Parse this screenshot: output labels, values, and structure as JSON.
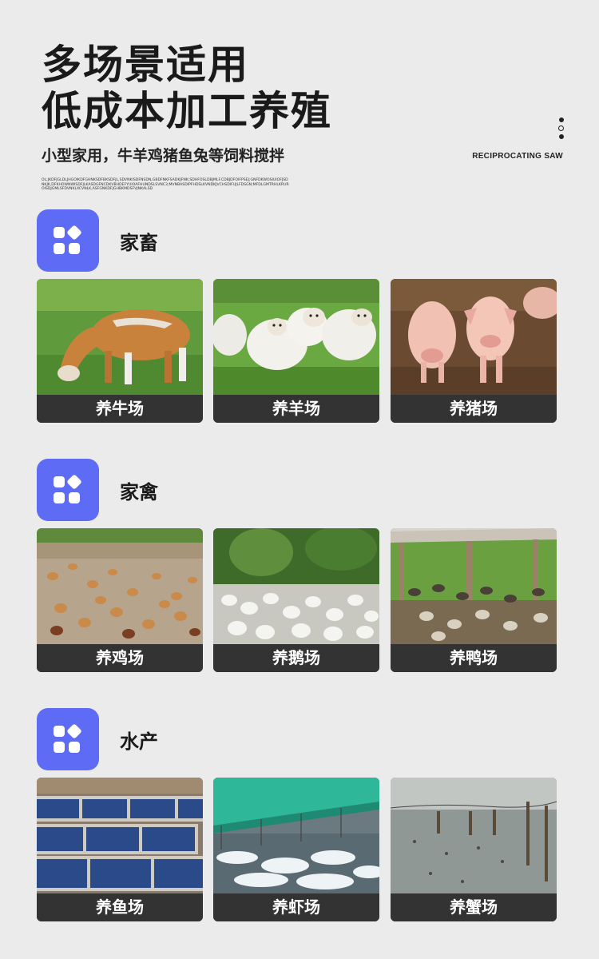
{
  "header": {
    "title_line1": "多场景适用",
    "title_line2": "低成本加工养殖",
    "subtitle": "小型家用，牛羊鸡猪鱼兔等饲料搅拌",
    "fineprint": "OL;JKDFJGLDLJHGOIKDFGHNKSDFBKSDFJL,SDVNKISDFNSDN,GBDFNKFSADKJFNK;SDHFOSLDBJMLF.CDBJDFOIFPSEJ;GNFDKWOSIUIOFJSDNKJK,DFKHOWNWISDFJLKASDGFNCDKVBHDEFYUIOAFHUNDSLSVNC3;MVNBASDIPFHDSLKVNDKJVCHSDIFUJLFDSGN;MFDLGMTRHLKRUROISDJGMLSFDVNKLXCVNLK,ASFGNKDFJGHBKMDSFVJNKALSD",
    "brand": "RECIPROCATING SAW"
  },
  "sections": [
    {
      "icon": "grid-apps-icon",
      "title": "家畜",
      "cards": [
        {
          "label": "养牛场",
          "image": "cow-photo"
        },
        {
          "label": "养羊场",
          "image": "sheep-photo"
        },
        {
          "label": "养猪场",
          "image": "pig-photo"
        }
      ]
    },
    {
      "icon": "grid-apps-icon",
      "title": "家禽",
      "cards": [
        {
          "label": "养鸡场",
          "image": "chicken-photo"
        },
        {
          "label": "养鹅场",
          "image": "goose-photo"
        },
        {
          "label": "养鸭场",
          "image": "duck-photo"
        }
      ]
    },
    {
      "icon": "grid-apps-icon",
      "title": "水产",
      "cards": [
        {
          "label": "养鱼场",
          "image": "fish-pond-photo"
        },
        {
          "label": "养虾场",
          "image": "shrimp-pond-photo"
        },
        {
          "label": "养蟹场",
          "image": "crab-pond-photo"
        }
      ]
    }
  ],
  "colors": {
    "background": "#ebebeb",
    "accent": "#5e6cf5",
    "label_bar": "#333333",
    "text": "#1a1a1a"
  }
}
